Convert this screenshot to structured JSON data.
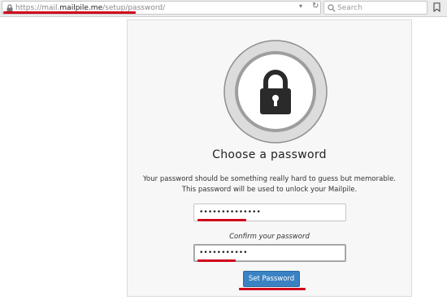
{
  "browser": {
    "url_prefix": "https://mail.",
    "url_host": "mailpile.me",
    "url_path": "/setup/password/",
    "search_placeholder": "Search",
    "reload_glyph": "↻",
    "dropdown_glyph": "▾",
    "icons": [
      "lock-icon",
      "reload-icon",
      "search-icon",
      "bookmark-icon"
    ]
  },
  "setup": {
    "emblem_icon": "padlock-icon",
    "title": "Choose a password",
    "description_line1": "Your password should be something really hard to guess but memorable.",
    "description_line2": "This password will be used to unlock your Mailpile.",
    "password_value": "••••••••••••••",
    "confirm_label": "Confirm your password",
    "confirm_value": "•••••••••••",
    "submit_label": "Set Password"
  },
  "colors": {
    "accent_button": "#3a82c2",
    "highlight": "#d0021b"
  }
}
